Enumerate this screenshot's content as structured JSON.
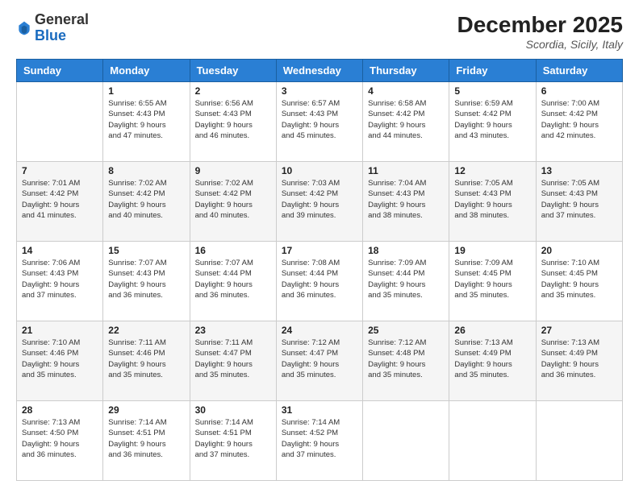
{
  "header": {
    "logo_line1": "General",
    "logo_line2": "Blue",
    "month": "December 2025",
    "location": "Scordia, Sicily, Italy"
  },
  "weekdays": [
    "Sunday",
    "Monday",
    "Tuesday",
    "Wednesday",
    "Thursday",
    "Friday",
    "Saturday"
  ],
  "weeks": [
    [
      {
        "day": "",
        "info": ""
      },
      {
        "day": "1",
        "info": "Sunrise: 6:55 AM\nSunset: 4:43 PM\nDaylight: 9 hours\nand 47 minutes."
      },
      {
        "day": "2",
        "info": "Sunrise: 6:56 AM\nSunset: 4:43 PM\nDaylight: 9 hours\nand 46 minutes."
      },
      {
        "day": "3",
        "info": "Sunrise: 6:57 AM\nSunset: 4:43 PM\nDaylight: 9 hours\nand 45 minutes."
      },
      {
        "day": "4",
        "info": "Sunrise: 6:58 AM\nSunset: 4:42 PM\nDaylight: 9 hours\nand 44 minutes."
      },
      {
        "day": "5",
        "info": "Sunrise: 6:59 AM\nSunset: 4:42 PM\nDaylight: 9 hours\nand 43 minutes."
      },
      {
        "day": "6",
        "info": "Sunrise: 7:00 AM\nSunset: 4:42 PM\nDaylight: 9 hours\nand 42 minutes."
      }
    ],
    [
      {
        "day": "7",
        "info": "Sunrise: 7:01 AM\nSunset: 4:42 PM\nDaylight: 9 hours\nand 41 minutes."
      },
      {
        "day": "8",
        "info": "Sunrise: 7:02 AM\nSunset: 4:42 PM\nDaylight: 9 hours\nand 40 minutes."
      },
      {
        "day": "9",
        "info": "Sunrise: 7:02 AM\nSunset: 4:42 PM\nDaylight: 9 hours\nand 40 minutes."
      },
      {
        "day": "10",
        "info": "Sunrise: 7:03 AM\nSunset: 4:42 PM\nDaylight: 9 hours\nand 39 minutes."
      },
      {
        "day": "11",
        "info": "Sunrise: 7:04 AM\nSunset: 4:43 PM\nDaylight: 9 hours\nand 38 minutes."
      },
      {
        "day": "12",
        "info": "Sunrise: 7:05 AM\nSunset: 4:43 PM\nDaylight: 9 hours\nand 38 minutes."
      },
      {
        "day": "13",
        "info": "Sunrise: 7:05 AM\nSunset: 4:43 PM\nDaylight: 9 hours\nand 37 minutes."
      }
    ],
    [
      {
        "day": "14",
        "info": "Sunrise: 7:06 AM\nSunset: 4:43 PM\nDaylight: 9 hours\nand 37 minutes."
      },
      {
        "day": "15",
        "info": "Sunrise: 7:07 AM\nSunset: 4:43 PM\nDaylight: 9 hours\nand 36 minutes."
      },
      {
        "day": "16",
        "info": "Sunrise: 7:07 AM\nSunset: 4:44 PM\nDaylight: 9 hours\nand 36 minutes."
      },
      {
        "day": "17",
        "info": "Sunrise: 7:08 AM\nSunset: 4:44 PM\nDaylight: 9 hours\nand 36 minutes."
      },
      {
        "day": "18",
        "info": "Sunrise: 7:09 AM\nSunset: 4:44 PM\nDaylight: 9 hours\nand 35 minutes."
      },
      {
        "day": "19",
        "info": "Sunrise: 7:09 AM\nSunset: 4:45 PM\nDaylight: 9 hours\nand 35 minutes."
      },
      {
        "day": "20",
        "info": "Sunrise: 7:10 AM\nSunset: 4:45 PM\nDaylight: 9 hours\nand 35 minutes."
      }
    ],
    [
      {
        "day": "21",
        "info": "Sunrise: 7:10 AM\nSunset: 4:46 PM\nDaylight: 9 hours\nand 35 minutes."
      },
      {
        "day": "22",
        "info": "Sunrise: 7:11 AM\nSunset: 4:46 PM\nDaylight: 9 hours\nand 35 minutes."
      },
      {
        "day": "23",
        "info": "Sunrise: 7:11 AM\nSunset: 4:47 PM\nDaylight: 9 hours\nand 35 minutes."
      },
      {
        "day": "24",
        "info": "Sunrise: 7:12 AM\nSunset: 4:47 PM\nDaylight: 9 hours\nand 35 minutes."
      },
      {
        "day": "25",
        "info": "Sunrise: 7:12 AM\nSunset: 4:48 PM\nDaylight: 9 hours\nand 35 minutes."
      },
      {
        "day": "26",
        "info": "Sunrise: 7:13 AM\nSunset: 4:49 PM\nDaylight: 9 hours\nand 35 minutes."
      },
      {
        "day": "27",
        "info": "Sunrise: 7:13 AM\nSunset: 4:49 PM\nDaylight: 9 hours\nand 36 minutes."
      }
    ],
    [
      {
        "day": "28",
        "info": "Sunrise: 7:13 AM\nSunset: 4:50 PM\nDaylight: 9 hours\nand 36 minutes."
      },
      {
        "day": "29",
        "info": "Sunrise: 7:14 AM\nSunset: 4:51 PM\nDaylight: 9 hours\nand 36 minutes."
      },
      {
        "day": "30",
        "info": "Sunrise: 7:14 AM\nSunset: 4:51 PM\nDaylight: 9 hours\nand 37 minutes."
      },
      {
        "day": "31",
        "info": "Sunrise: 7:14 AM\nSunset: 4:52 PM\nDaylight: 9 hours\nand 37 minutes."
      },
      {
        "day": "",
        "info": ""
      },
      {
        "day": "",
        "info": ""
      },
      {
        "day": "",
        "info": ""
      }
    ]
  ]
}
